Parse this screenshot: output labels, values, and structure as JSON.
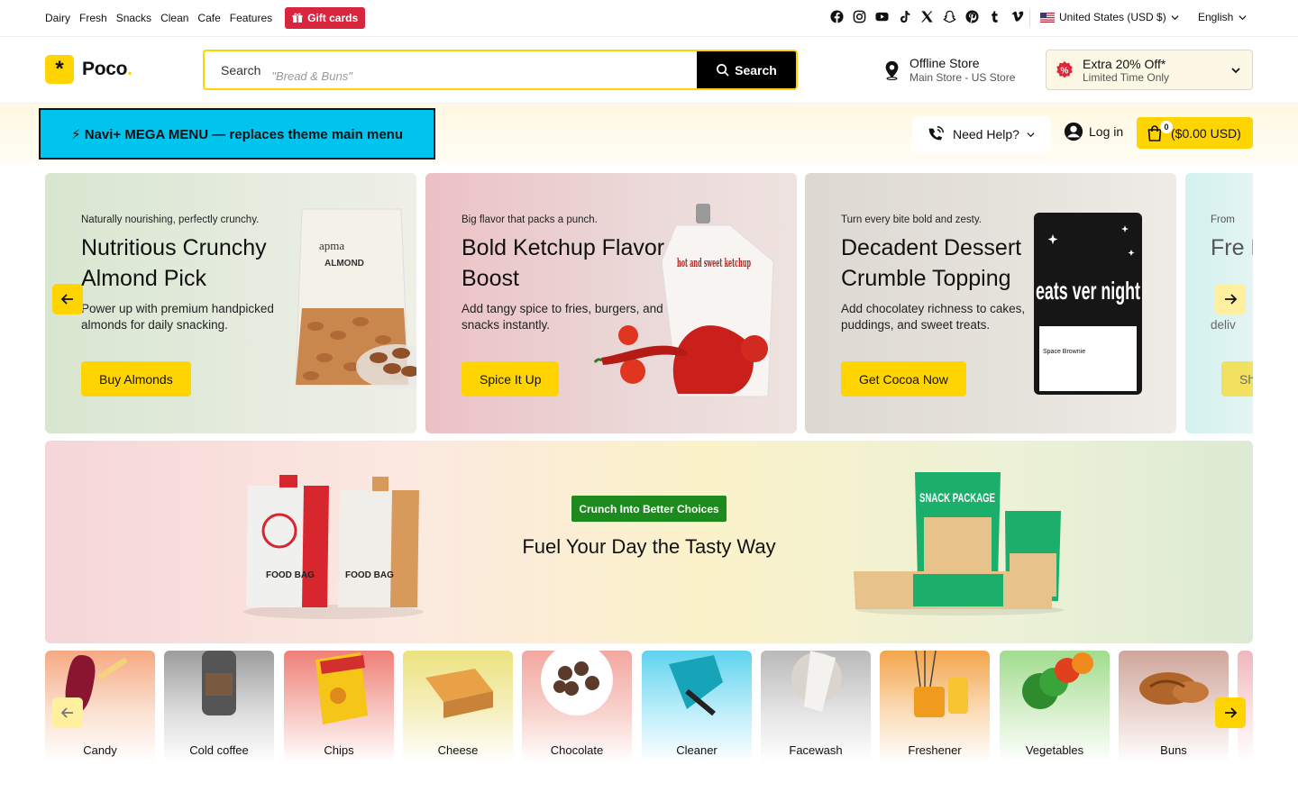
{
  "topbar": {
    "nav": [
      "Dairy",
      "Fresh",
      "Snacks",
      "Clean",
      "Cafe",
      "Features"
    ],
    "gift_label": "Gift cards",
    "socials": [
      "facebook-icon",
      "instagram-icon",
      "youtube-icon",
      "tiktok-icon",
      "x-icon",
      "snapchat-icon",
      "pinterest-icon",
      "tumblr-icon",
      "vimeo-icon"
    ],
    "country": "United States (USD $)",
    "language": "English"
  },
  "header": {
    "logo_text": "Poco",
    "search_label": "Search",
    "search_placeholder": "\"Bread & Buns\"",
    "search_button": "Search",
    "store_title": "Offline Store",
    "store_sub": "Main Store - US Store",
    "offer_title": "Extra 20% Off*",
    "offer_sub": "Limited Time Only"
  },
  "menubar": {
    "mega_label": "⚡ Navi+ MEGA MENU — replaces theme main menu",
    "help_label": "Need Help?",
    "login_label": "Log in",
    "cart_count": "0",
    "cart_total": "($0.00 USD)"
  },
  "slides": [
    {
      "kicker": "Naturally nourishing, perfectly crunchy.",
      "title": "Nutritious Crunchy Almond Pick",
      "desc": "Power up with premium handpicked almonds for daily snacking.",
      "cta": "Buy Almonds",
      "art_brand": "apma",
      "art_label": "ALMOND"
    },
    {
      "kicker": "Big flavor that packs a punch.",
      "title": "Bold Ketchup Flavor Boost",
      "desc": "Add tangy spice to fries, burgers, and snacks instantly.",
      "cta": "Spice It Up",
      "art_label": "hot and sweet ketchup"
    },
    {
      "kicker": "Turn every bite bold and zesty.",
      "title": "Decadent Dessert Crumble Topping",
      "desc": "Add chocolatey richness to cakes, puddings, and sweet treats.",
      "cta": "Get Cocoa Now",
      "art_label": "eats ver night",
      "art_sub": "Space Brownie"
    },
    {
      "kicker": "From",
      "title": "Fre Do",
      "desc": "deliv",
      "cta": "Sh"
    }
  ],
  "banner": {
    "badge": "Crunch Into Better Choices",
    "title": "Fuel Your Day the Tasty Way",
    "left_bag_text": "FOOD BAG",
    "right_pack_text": "SNACK PACKAGE"
  },
  "categories": [
    "Candy",
    "Cold coffee",
    "Chips",
    "Cheese",
    "Chocolate",
    "Cleaner",
    "Facewash",
    "Freshener",
    "Vegetables",
    "Buns"
  ],
  "colors": {
    "accent": "#ffd400",
    "gift": "#d7263d",
    "mega": "#00c4ee",
    "badge": "#1d8a1d"
  }
}
